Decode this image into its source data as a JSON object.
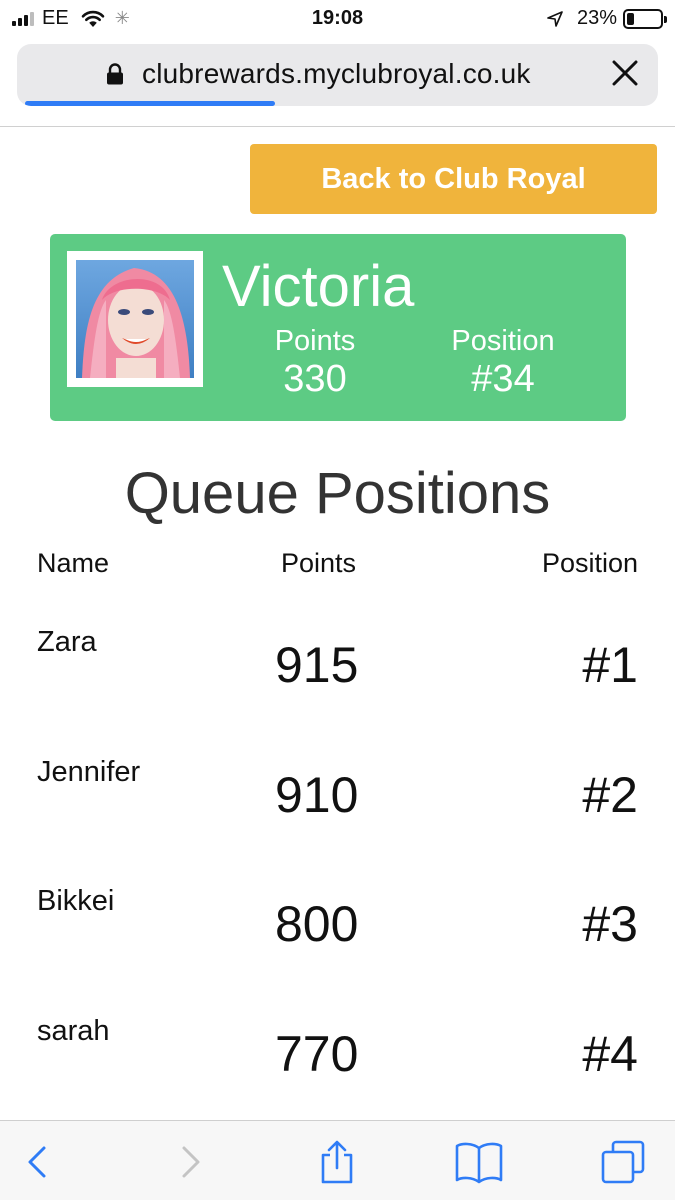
{
  "status_bar": {
    "carrier": "EE",
    "time": "19:08",
    "battery": "23%",
    "battery_level": 0.23
  },
  "browser": {
    "url": "clubrewards.myclubroyal.co.uk",
    "load_progress": 0.4,
    "icons": [
      "lock-icon",
      "close-icon",
      "back-icon",
      "forward-icon",
      "share-icon",
      "bookmarks-icon",
      "tabs-icon"
    ],
    "accent": "#2f7cf6"
  },
  "page": {
    "back_button_label": "Back to Club Royal",
    "back_button_color": "#f0b43c",
    "card_color": "#5dcb84",
    "profile": {
      "name": "Victoria",
      "points_label": "Points",
      "points": "330",
      "position_label": "Position",
      "position": "#34"
    },
    "queue": {
      "title": "Queue Positions",
      "headers": {
        "name": "Name",
        "points": "Points",
        "position": "Position"
      },
      "rows": [
        {
          "name": "Zara",
          "points": "915",
          "position": "#1"
        },
        {
          "name": "Jennifer",
          "points": "910",
          "position": "#2"
        },
        {
          "name": "Bikkei",
          "points": "800",
          "position": "#3"
        },
        {
          "name": "sarah",
          "points": "770",
          "position": "#4"
        }
      ]
    }
  }
}
